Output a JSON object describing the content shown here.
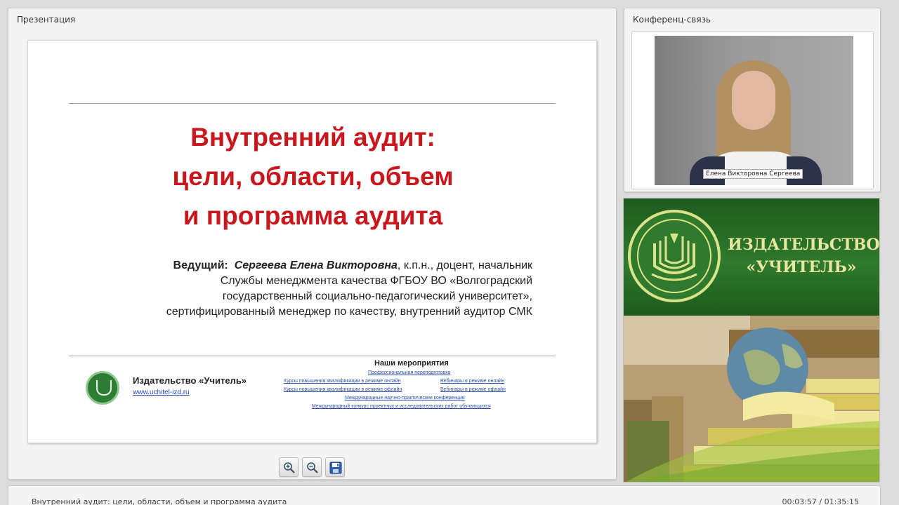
{
  "presentation_panel": {
    "title": "Презентация",
    "slide": {
      "title_lines": [
        "Внутренний аудит:",
        "цели, области, объем",
        "и программа аудита"
      ],
      "presenter_label": "Ведущий:",
      "presenter_name": "Сергеева Елена Викторовна",
      "presenter_line1_rest": ", к.п.н., доцент, начальник",
      "presenter_lines": [
        "Службы менеджмента качества ФГБОУ ВО «Волгоградский",
        "государственный социально-педагогический университет»,",
        "сертифицированный менеджер по качеству, внутренний аудитор СМК"
      ],
      "publisher_name": "Издательство «Учитель»",
      "publisher_url": "www.uchitel-izd.ru",
      "events_heading": "Наши мероприятия",
      "events": [
        "Профессиональная переподготовка",
        "Курсы повышения квалификации в режиме онлайн",
        "Вебинары в режиме онлайн",
        "Курсы повышения квалификации в режиме офлайн",
        "Вебинары в режиме офлайн",
        "Международные научно-практические конференции",
        "Международный конкурс проектных и исследовательских работ обучающихся"
      ]
    },
    "toolbar": {
      "zoom_in_icon": "zoom-in-icon",
      "zoom_out_icon": "zoom-out-icon",
      "save_icon": "floppy-disk-icon"
    }
  },
  "conference_panel": {
    "title": "Конференц-связь",
    "participant_name": "Елена Викторовна Сергеева"
  },
  "banner": {
    "line1": "ИЗДАТЕЛЬСТВО",
    "line2": "«УЧИТЕЛЬ»",
    "colors": {
      "green": "#2f7a2c",
      "gold_text": "#e8e6a0"
    }
  },
  "status_bar": {
    "title": "Внутренний аудит: цели, области, объем и программа аудита",
    "time": "00:03:57 / 01:35:15"
  },
  "colors": {
    "slide_title": "#c8181e",
    "link": "#2b4fb0"
  }
}
